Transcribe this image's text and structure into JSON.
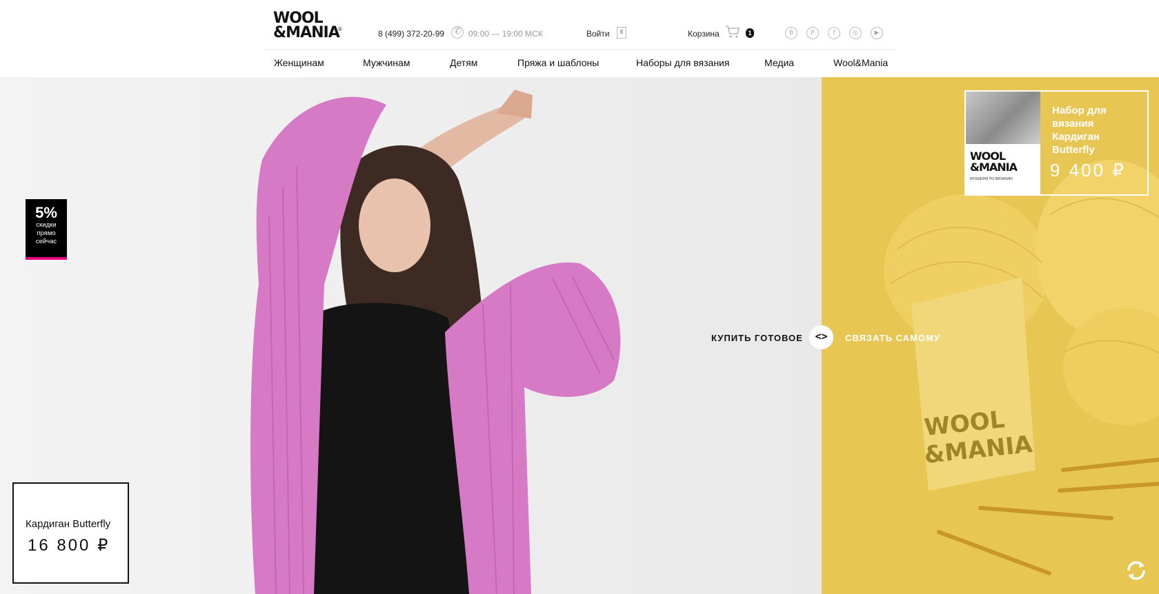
{
  "brand": {
    "logo_line1": "WOOL",
    "logo_line2": "&MANIA",
    "logo_reg": "®"
  },
  "header": {
    "phone": "8 (499) 372-20-99",
    "hours": "09:00 — 19:00 МСК",
    "login_label": "Войти",
    "cart_label": "Корзина",
    "cart_count": "1",
    "social": [
      "vk-icon",
      "pinterest-icon",
      "facebook-icon",
      "instagram-icon",
      "youtube-icon"
    ],
    "social_glyphs": [
      "B",
      "P",
      "f",
      "◎",
      "▶"
    ]
  },
  "nav": {
    "items": [
      "Женщинам",
      "Мужчинам",
      "Детям",
      "Пряжа и шаблоны",
      "Наборы для вязания",
      "Медиа",
      "Wool&Mania"
    ]
  },
  "promo": {
    "percent": "5%",
    "line1": "скидки",
    "line2": "прямо",
    "line3": "сейчас",
    "accent": "#e6007e"
  },
  "product": {
    "name": "Кардиган Butterfly",
    "price": "16 800 ₽"
  },
  "kit": {
    "title": "Набор для вязания Кардиган Butterfly",
    "price": "9 400 ₽",
    "thumb_logo_line1": "WOOL",
    "thumb_logo_line2": "&MANIA",
    "thumb_caption": "БРОШЮРА ПО ВЯЗАНИЮ"
  },
  "switcher": {
    "buy_ready": "КУПИТЬ ГОТОВОЕ",
    "knit_yourself": "СВЯЗАТЬ САМОМУ",
    "toggle_glyph": "<>"
  },
  "colors": {
    "yellow": "#e8c653",
    "pink": "#d97ac8",
    "black": "#111111",
    "hero_bg": "#eeeeee"
  }
}
